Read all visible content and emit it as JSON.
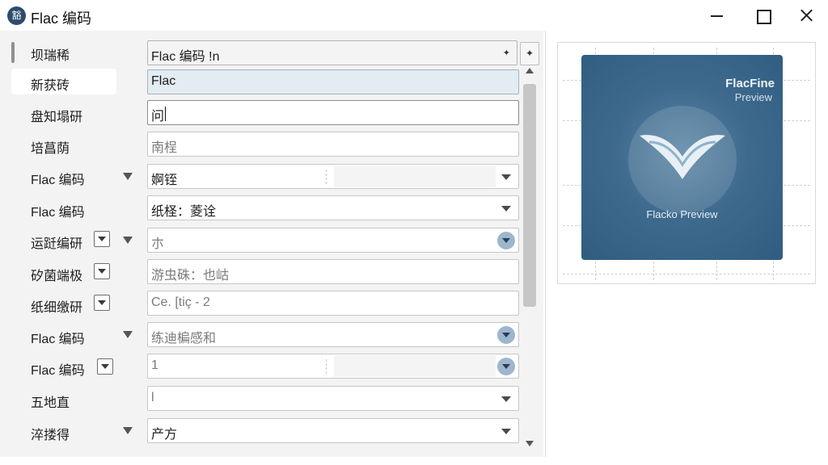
{
  "window": {
    "title": "Flac 编码",
    "app_icon_glyph": "豁",
    "icons": [
      "minimize-icon",
      "maximize-icon",
      "close-icon"
    ]
  },
  "rows": [
    {
      "label": "坝瑞稀",
      "value": "Flac 编码 !n",
      "control": "topfield"
    },
    {
      "label": "新获砖",
      "value": "Flac",
      "control": "text-highlight"
    },
    {
      "label": "盘知塌研",
      "value": "问",
      "control": "text-active"
    },
    {
      "label": "培菖荫",
      "value": "南桯",
      "control": "text"
    },
    {
      "label": "Flac 编码",
      "value": "婀铚",
      "control": "dropdown"
    },
    {
      "label": "Flac 编码",
      "value": "纸柽：菱诠",
      "control": "dropdown"
    },
    {
      "label": "运跹编研",
      "value": "朩",
      "control": "dropdown-circle"
    },
    {
      "label": "矽菌端极",
      "value": "游虫硃：也岵",
      "control": "text"
    },
    {
      "label": "纸细缴研",
      "value": "Ce. [tiç - 2",
      "control": "text"
    },
    {
      "label": "Flac 编码",
      "value": "练迪楄感和",
      "control": "dropdown-circle"
    },
    {
      "label": "Flac 编码",
      "value": "1",
      "control": "dropdown-circle"
    },
    {
      "label": "五地直",
      "value": "l",
      "control": "dropdown"
    },
    {
      "label": "淬搂得",
      "value": "产方",
      "control": "dropdown"
    }
  ],
  "preview": {
    "title": "FlacFine",
    "subtitle": "Preview",
    "caption": "Flacko Preview",
    "colors": {
      "cover": "#3e6a8e",
      "accent": "#9db6ce"
    }
  }
}
